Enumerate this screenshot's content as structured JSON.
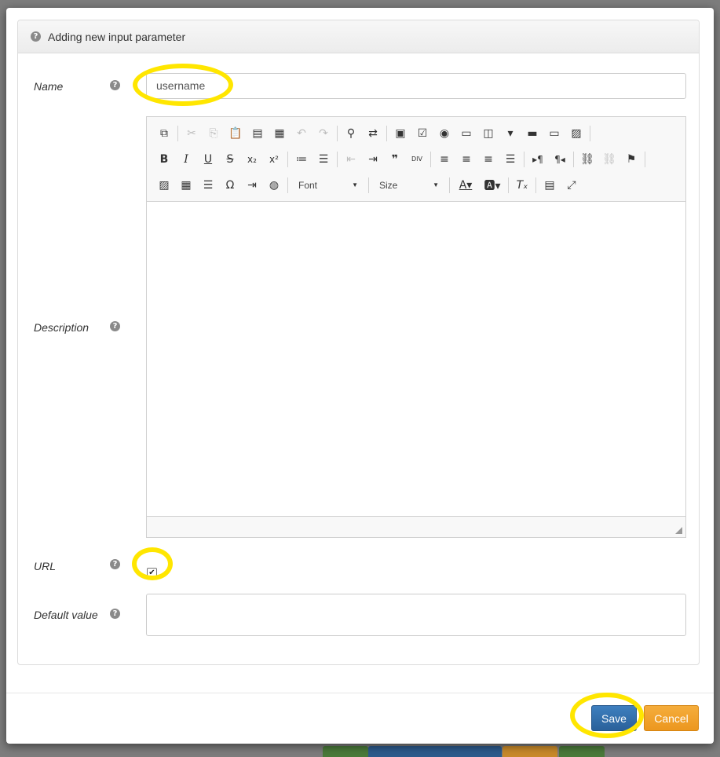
{
  "dialog": {
    "title": "Adding new input parameter"
  },
  "fields": {
    "name_label": "Name",
    "name_value": "username",
    "description_label": "Description",
    "url_label": "URL",
    "url_checked": true,
    "default_label": "Default value",
    "default_value": ""
  },
  "editor": {
    "font_label": "Font",
    "size_label": "Size",
    "toolbar_rows": [
      [
        "source-icon",
        "|",
        "cut-icon",
        "copy-icon",
        "paste-icon",
        "paste-text-icon",
        "paste-word-icon",
        "undo-icon",
        "redo-icon",
        "|",
        "find-icon",
        "replace-icon",
        "|",
        "form-icon",
        "checkbox-icon",
        "radio-icon",
        "textfield-icon",
        "textarea-icon",
        "select-icon",
        "button-icon",
        "image-button-icon",
        "hidden-field-icon",
        "|"
      ],
      [
        "bold-icon",
        "italic-icon",
        "underline-icon",
        "strike-icon",
        "subscript-icon",
        "superscript-icon",
        "|",
        "numbered-list-icon",
        "bulleted-list-icon",
        "|",
        "outdent-icon",
        "indent-icon",
        "blockquote-icon",
        "div-icon",
        "|",
        "align-left-icon",
        "align-center-icon",
        "align-right-icon",
        "justify-icon",
        "|",
        "ltr-icon",
        "rtl-icon",
        "|",
        "link-icon",
        "unlink-icon",
        "anchor-icon",
        "|"
      ],
      [
        "image-icon",
        "table-icon",
        "horizontal-rule-icon",
        "special-char-icon",
        "page-break-icon",
        "iframe-icon",
        "|",
        "font-combo",
        "|",
        "size-combo",
        "|",
        "text-color-icon",
        "bg-color-icon",
        "|",
        "remove-format-icon",
        "|",
        "show-blocks-icon",
        "maximize-icon"
      ]
    ]
  },
  "buttons": {
    "save": "Save",
    "cancel": "Cancel"
  },
  "colors": {
    "highlight": "#ffe600",
    "save": "#2a619a",
    "cancel": "#ec971f"
  }
}
